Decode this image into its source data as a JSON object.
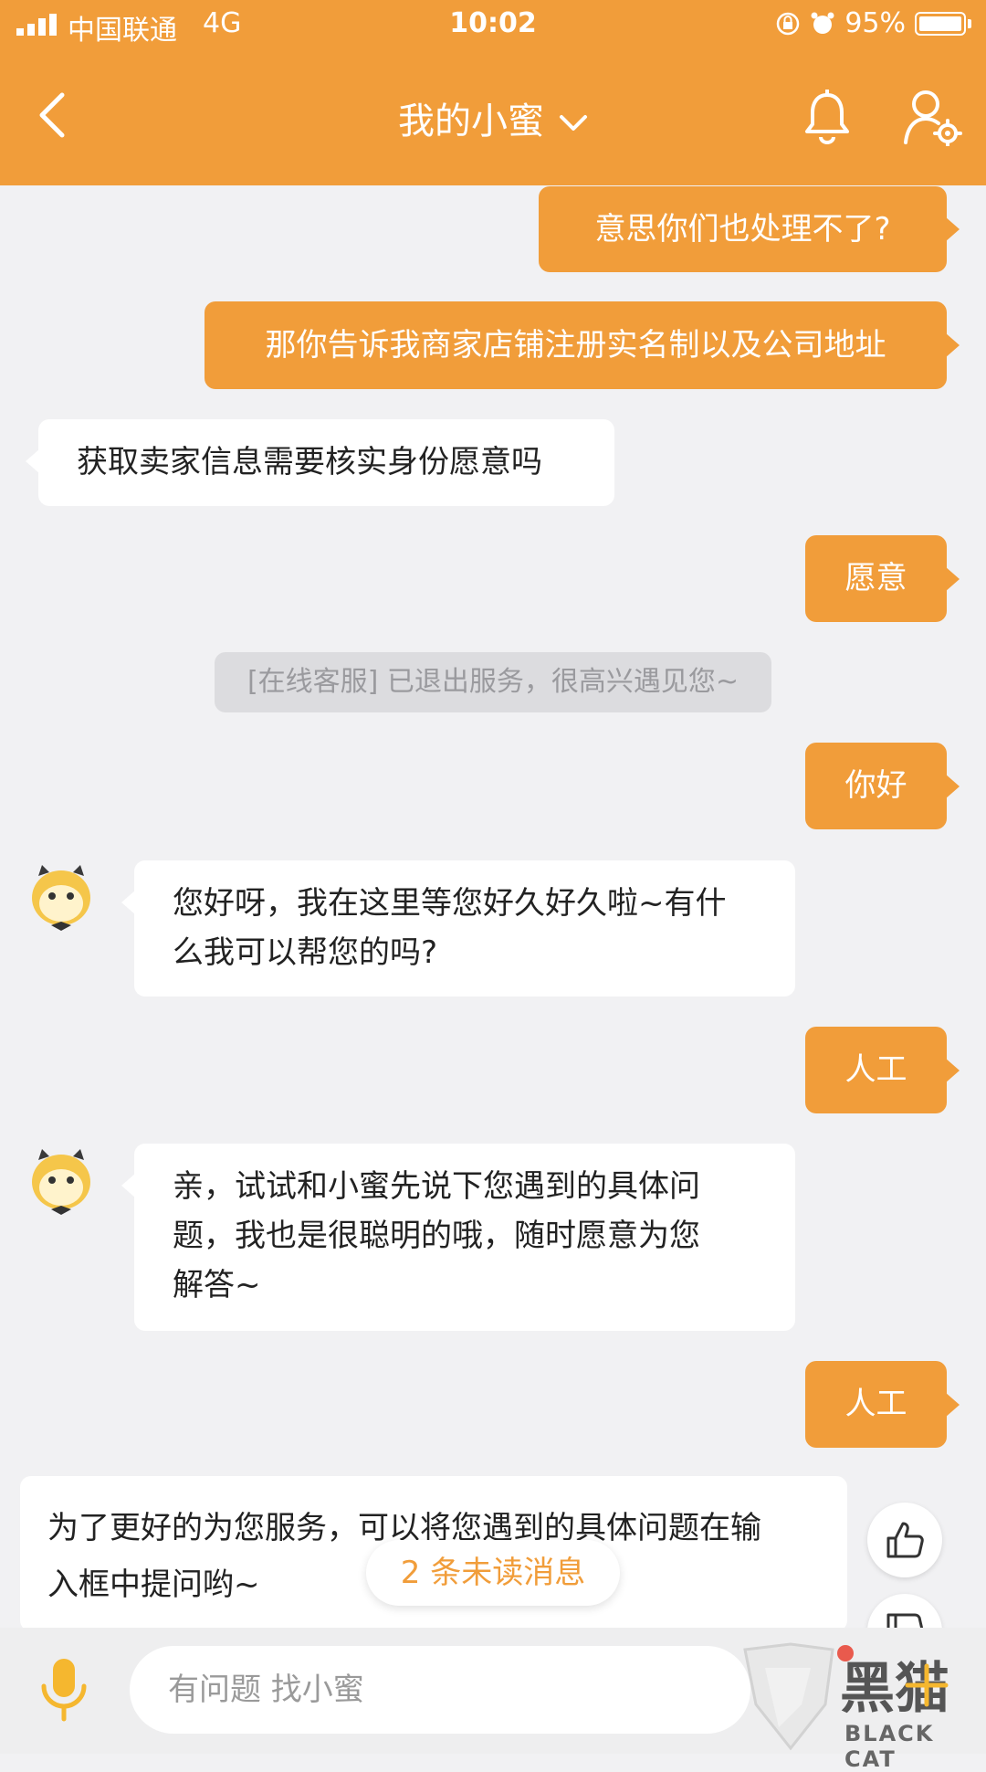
{
  "status_bar": {
    "carrier": "中国联通",
    "network": "4G",
    "time": "10:02",
    "battery": "95%"
  },
  "header": {
    "title": "我的小蜜"
  },
  "messages": [
    {
      "side": "right",
      "text": "意思你们也处理不了?"
    },
    {
      "side": "right",
      "text": "那你告诉我商家店铺注册实名制以及公司地址"
    },
    {
      "side": "left",
      "text": "获取卖家信息需要核实身份愿意吗"
    },
    {
      "side": "right",
      "text": "愿意"
    },
    {
      "side": "system",
      "text": "[在线客服] 已退出服务，很高兴遇见您~"
    },
    {
      "side": "right",
      "text": "你好"
    },
    {
      "side": "left",
      "lines": [
        "您好呀，我在这里等您好久好久啦~有什",
        "么我可以帮您的吗?"
      ]
    },
    {
      "side": "right",
      "text": "人工"
    },
    {
      "side": "left",
      "lines": [
        "亲，试试和小蜜先说下您遇到的具体问",
        "题，我也是很聪明的哦，随时愿意为您",
        "解答~"
      ]
    },
    {
      "side": "right",
      "text": "人工"
    },
    {
      "side": "left",
      "lines": [
        "为了更好的为您服务，可以将您遇到的具体问题在输",
        "入框中提问哟~"
      ]
    }
  ],
  "unread_badge": "2 条未读消息",
  "input": {
    "placeholder": "有问题 找小蜜"
  },
  "watermark": {
    "brand": "黑猫",
    "brand_en": "BLACK CAT"
  },
  "colors": {
    "accent": "#f19d3a",
    "background": "#f1f1f3"
  },
  "icons": [
    "back-arrow-icon",
    "chevron-down-icon",
    "bell-icon",
    "user-settings-icon",
    "bot-avatar-icon",
    "thumbs-up-icon",
    "thumbs-down-icon",
    "microphone-icon",
    "plus-icon"
  ]
}
